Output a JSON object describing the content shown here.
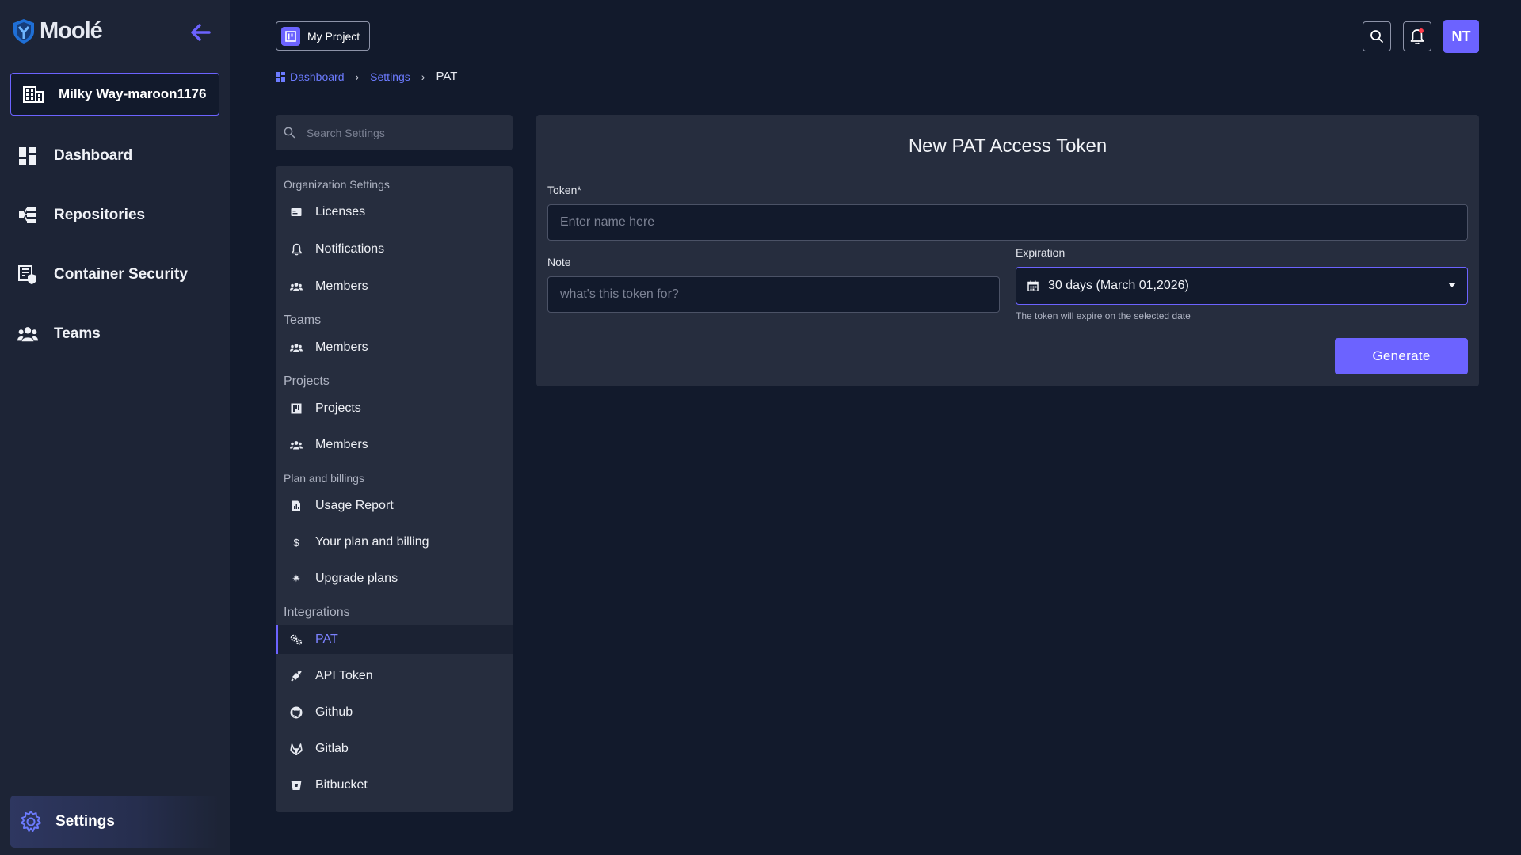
{
  "brand": {
    "name": "Moolé"
  },
  "sidebar": {
    "org_name": "Milky Way-maroon1176",
    "items": [
      {
        "label": "Dashboard",
        "icon": "dashboard-icon"
      },
      {
        "label": "Repositories",
        "icon": "repositories-icon"
      },
      {
        "label": "Container Security",
        "icon": "container-security-icon"
      },
      {
        "label": "Teams",
        "icon": "teams-icon"
      }
    ],
    "settings_label": "Settings"
  },
  "header": {
    "project_label": "My Project",
    "avatar_initials": "NT"
  },
  "breadcrumb": {
    "dashboard": "Dashboard",
    "settings": "Settings",
    "current": "PAT"
  },
  "settings_search": {
    "placeholder": "Search Settings"
  },
  "settings_menu": {
    "org_section": "Organization Settings",
    "licenses": "Licenses",
    "notifications": "Notifications",
    "org_members": "Members",
    "teams_section": "Teams",
    "teams_members": "Members",
    "projects_section": "Projects",
    "projects": "Projects",
    "projects_members": "Members",
    "plan_section": "Plan and billings",
    "usage_report": "Usage Report",
    "plan_billing": "Your plan and billing",
    "upgrade_plans": "Upgrade plans",
    "integrations_section": "Integrations",
    "pat": "PAT",
    "api_token": "API Token",
    "github": "Github",
    "gitlab": "Gitlab",
    "bitbucket": "Bitbucket"
  },
  "form": {
    "title": "New PAT Access Token",
    "token_label": "Token*",
    "token_placeholder": "Enter name here",
    "note_label": "Note",
    "note_placeholder": "what's this token for?",
    "expiration_label": "Expiration",
    "expiration_value": "30 days (March 01,2026)",
    "expiration_helper": "The token will expire on the selected date",
    "generate_label": "Generate"
  },
  "colors": {
    "accent": "#6c63ff",
    "background": "#121a2c",
    "sidebar": "#1d2436",
    "panel": "#262d3e"
  }
}
